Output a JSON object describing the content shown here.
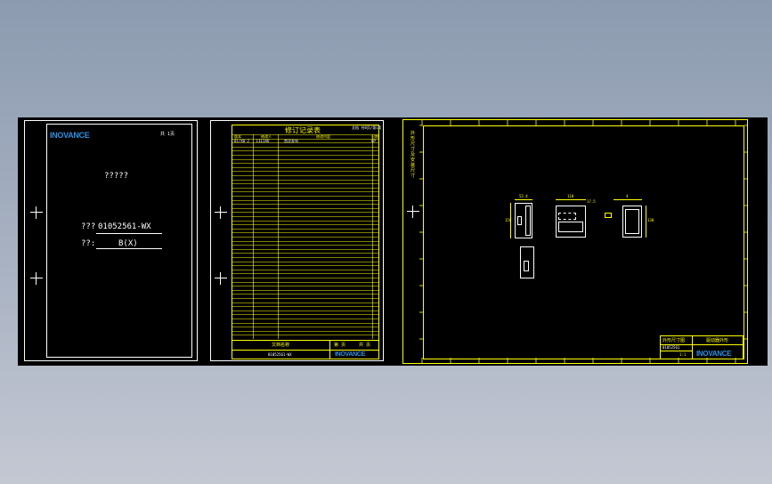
{
  "colors": {
    "background_top": "#8c9bb0",
    "canvas": "#000000",
    "ink_white": "#ffffff",
    "ink_yellow": "#ffff00",
    "brand_blue": "#2e8fe0"
  },
  "cover": {
    "logo": "INOVANCE",
    "page_tag": "共 1页",
    "title": "?????",
    "code_label": "???",
    "code_value": "01052561-WX",
    "version_label": "??:",
    "version_value": "B(X)",
    "icons": [
      "crosshair-icon",
      "crosshair-icon"
    ]
  },
  "revision": {
    "title": "修订记录表",
    "header_right": "文档 共8页/第1页",
    "col_headers": [
      "版本",
      "修改人",
      "修改内容",
      "日期"
    ],
    "first_row": [
      "01/X0-2",
      "LILIAO",
      "首次发布",
      "GP"
    ],
    "footer_name": "文档名称",
    "footer_code": "01052561-WX",
    "footer_a": "第 页",
    "footer_b": "共 页",
    "logo": "INOVANCE"
  },
  "drawing": {
    "side_text": "外形尺寸及安装尺寸",
    "dims": {
      "top_a": "52.4",
      "top_b": "110",
      "top_c": "17.5",
      "top_d": "4",
      "left_h": "150",
      "right_h": "130"
    },
    "title_block": {
      "left_title": "外形尺寸图",
      "right_title": "驱动器外形",
      "code": "01052561",
      "scale": "1:1",
      "logo": "INOVANCE"
    }
  }
}
